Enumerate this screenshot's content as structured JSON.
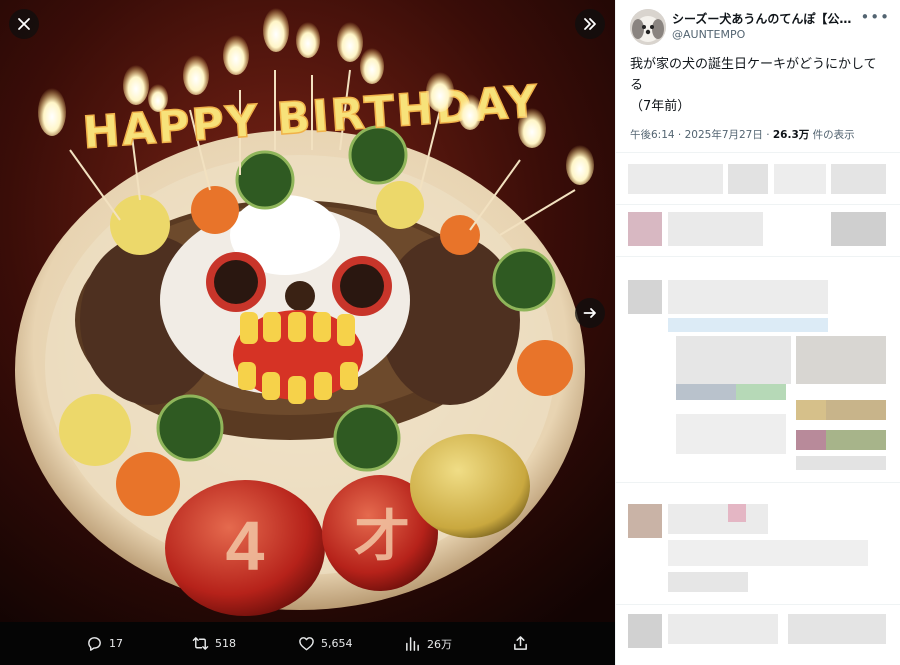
{
  "media_viewer": {
    "close_icon": "close-icon",
    "expand_icon": "expand-icon",
    "next_icon": "arrow-right-icon",
    "photo_text": {
      "candles": "HAPPY BIRTHDAY",
      "apple_left": "4",
      "apple_right": "才"
    },
    "actions": {
      "replies": "17",
      "reposts": "518",
      "likes": "5,654",
      "views": "26万"
    }
  },
  "tweet": {
    "display_name": "シーズー犬あうんのてんぽ【公式…",
    "handle": "@AUNTEMPO",
    "text": "我が家の犬の誕生日ケーキがどうにかしてる",
    "subtext": "（7年前）",
    "time": "午後6:14 · 2025年7月27日 · ",
    "views_count": "26.3万",
    "views_label": " 件の表示"
  },
  "colors": {
    "accent": "#1d9bf0",
    "text_primary": "#0f1419",
    "text_secondary": "#536471"
  }
}
